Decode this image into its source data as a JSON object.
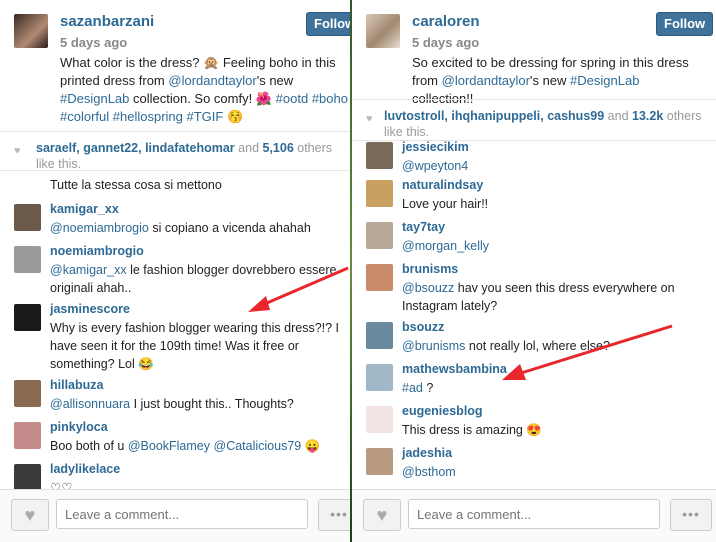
{
  "left": {
    "username": "sazanbarzani",
    "time": "5 days ago",
    "follow_label": "Follow",
    "caption": [
      {
        "t": "text",
        "v": "What color is the dress? 🙊 Feeling boho in this printed dress from "
      },
      {
        "t": "link",
        "v": "@lordandtaylor"
      },
      {
        "t": "text",
        "v": "'s new "
      },
      {
        "t": "link",
        "v": "#DesignLab"
      },
      {
        "t": "text",
        "v": " collection. So comfy! 🌺 "
      },
      {
        "t": "link",
        "v": "#ootd"
      },
      {
        "t": "text",
        "v": " "
      },
      {
        "t": "link",
        "v": "#boho"
      },
      {
        "t": "text",
        "v": " "
      },
      {
        "t": "link",
        "v": "#colorful"
      },
      {
        "t": "text",
        "v": " "
      },
      {
        "t": "link",
        "v": "#hellospring"
      },
      {
        "t": "text",
        "v": " "
      },
      {
        "t": "link",
        "v": "#TGIF"
      },
      {
        "t": "text",
        "v": " 😚"
      }
    ],
    "likes": {
      "users": "saraelf, gannet22, lindafatehomar",
      "and": " and ",
      "count": "5,106",
      "rest": " others like this."
    },
    "top_text": "Tutte la stessa cosa si mettono",
    "comments": [
      {
        "user": "kamigar_xx",
        "parts": [
          {
            "t": "link",
            "v": "@noemiambrogio"
          },
          {
            "t": "text",
            "v": " si copiano a vicenda ahahah"
          }
        ],
        "color": "#6b5a4a"
      },
      {
        "user": "noemiambrogio",
        "parts": [
          {
            "t": "link",
            "v": "@kamigar_xx"
          },
          {
            "t": "text",
            "v": " le fashion blogger dovrebbero essere originali ahah.."
          }
        ],
        "color": "#9a9a9a"
      },
      {
        "user": "jasminescore",
        "parts": [
          {
            "t": "text",
            "v": "Why is every fashion blogger wearing this dress?!? I have seen it for the 109th time! Was it free or something? Lol 😂"
          }
        ],
        "color": "#1a1a1a"
      },
      {
        "user": "hillabuza",
        "parts": [
          {
            "t": "link",
            "v": "@allisonnuara"
          },
          {
            "t": "text",
            "v": " I just bought this.. Thoughts?"
          }
        ],
        "color": "#8a6a50"
      },
      {
        "user": "pinkyloca",
        "parts": [
          {
            "t": "text",
            "v": "Boo both of u "
          },
          {
            "t": "link",
            "v": "@BookFlamey"
          },
          {
            "t": "text",
            "v": " "
          },
          {
            "t": "link",
            "v": "@Catalicious79"
          },
          {
            "t": "text",
            "v": " 😛"
          }
        ],
        "color": "#c48a8a"
      },
      {
        "user": "ladylikelace",
        "parts": [
          {
            "t": "text",
            "v": "♡♡"
          }
        ],
        "color": "#3a3a3a"
      }
    ],
    "input_placeholder": "Leave a comment...",
    "more_label": "•••"
  },
  "right": {
    "username": "caraloren",
    "time": "5 days ago",
    "follow_label": "Follow",
    "caption": [
      {
        "t": "text",
        "v": "So excited to be dressing for spring in this dress from "
      },
      {
        "t": "link",
        "v": "@lordandtaylor"
      },
      {
        "t": "text",
        "v": "'s new "
      },
      {
        "t": "link",
        "v": "#DesignLab"
      },
      {
        "t": "text",
        "v": " collection!!"
      }
    ],
    "likes": {
      "users": "luvtostroll, ihqhanipuppeli, cashus99",
      "and": " and ",
      "count": "13.2k",
      "rest": " others like this."
    },
    "comments": [
      {
        "user": "jessiecikim",
        "parts": [
          {
            "t": "link",
            "v": "@wpeyton4"
          }
        ],
        "color": "#7a6a5a"
      },
      {
        "user": "naturalindsay",
        "parts": [
          {
            "t": "text",
            "v": "Love your hair!!"
          }
        ],
        "color": "#c8a060"
      },
      {
        "user": "tay7tay",
        "parts": [
          {
            "t": "link",
            "v": "@morgan_kelly"
          }
        ],
        "color": "#b8a898"
      },
      {
        "user": "brunisms",
        "parts": [
          {
            "t": "link",
            "v": "@bsouzz"
          },
          {
            "t": "text",
            "v": " hav you seen this dress everywhere on Instagram lately?"
          }
        ],
        "color": "#c88a6a"
      },
      {
        "user": "bsouzz",
        "parts": [
          {
            "t": "link",
            "v": "@brunisms"
          },
          {
            "t": "text",
            "v": " not really lol, where else?"
          }
        ],
        "color": "#6a8aa0"
      },
      {
        "user": "mathewsbambina",
        "parts": [
          {
            "t": "link",
            "v": "#ad"
          },
          {
            "t": "text",
            "v": " ?"
          }
        ],
        "color": "#a0b8c8"
      },
      {
        "user": "eugeniesblog",
        "parts": [
          {
            "t": "text",
            "v": "This dress is amazing 😍"
          }
        ],
        "color": "#f2e4e4"
      },
      {
        "user": "jadeshia",
        "parts": [
          {
            "t": "link",
            "v": "@bsthom"
          }
        ],
        "color": "#b89a80"
      }
    ],
    "input_placeholder": "Leave a comment...",
    "more_label": "•••"
  },
  "colors": {
    "link": "#2e6a95",
    "follow_bg": "#3f729b",
    "arrow": "#e8262b"
  },
  "icons": {
    "like": "heart-icon",
    "more": "ellipsis-icon"
  }
}
